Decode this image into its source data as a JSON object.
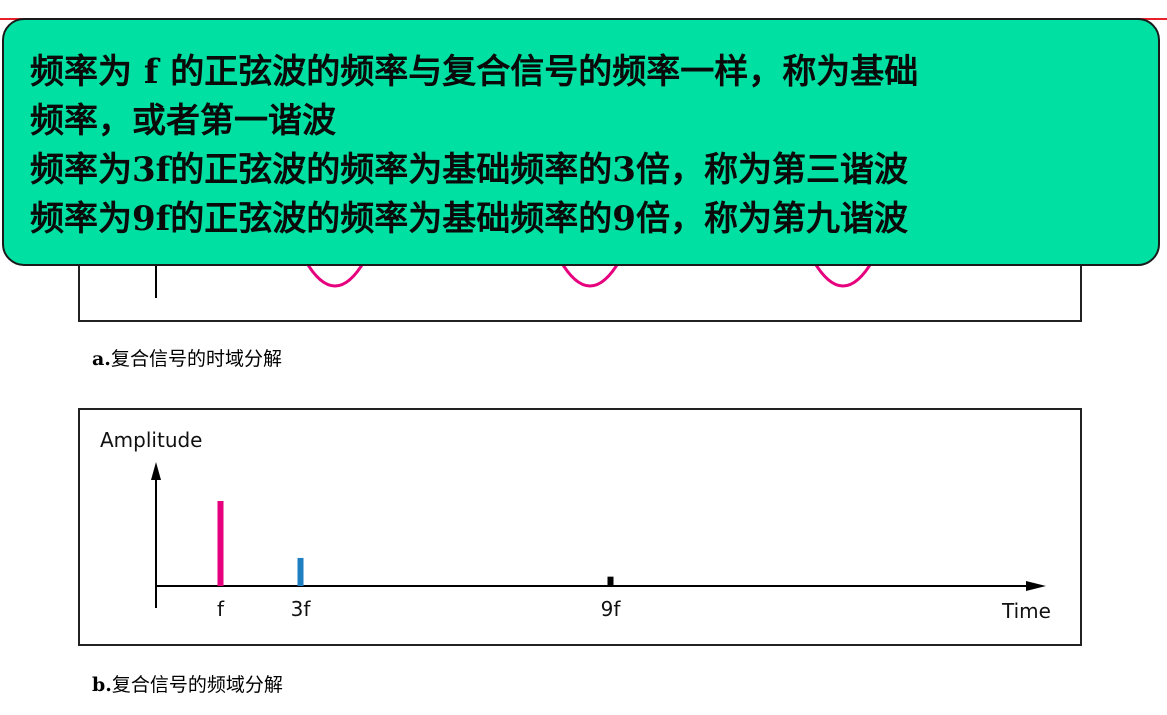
{
  "note": {
    "lines": [
      "频率为 f 的正弦波的频率与复合信号的频率一样，称为基础",
      "频率，或者第一谐波",
      "频率为3f的正弦波的频率为基础频率的3倍，称为第三谐波",
      "频率为9f的正弦波的频率为基础频率的9倍，称为第九谐波"
    ]
  },
  "panel_a": {
    "caption_letter": "a.",
    "caption_text": "复合信号的时域分解"
  },
  "panel_b": {
    "caption_letter": "b.",
    "caption_text": "复合信号的频域分解"
  },
  "colors": {
    "top_rule": "#e8202a",
    "note_fill": "#00e0a2",
    "fundamental": "#e6007e",
    "third_harmonic": "#1f7fc0",
    "ninth_harmonic": "#000000"
  },
  "chart_data": {
    "type": "bar",
    "ylabel": "Amplitude",
    "xlabel": "Time",
    "categories": [
      "f",
      "3f",
      "9f"
    ],
    "values": [
      1.0,
      0.33,
      0.11
    ],
    "bar_colors": [
      "#e6007e",
      "#1f7fc0",
      "#000000"
    ],
    "x_positions": [
      1,
      3,
      9
    ],
    "grid": false
  }
}
